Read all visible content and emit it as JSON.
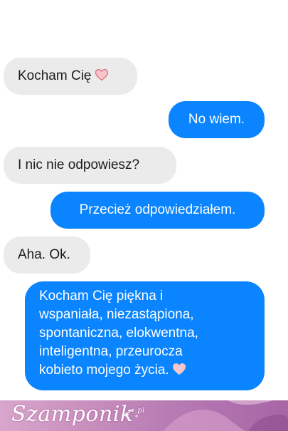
{
  "messages": [
    {
      "direction": "incoming",
      "text": "Kocham Cię",
      "icon": "heart-icon"
    },
    {
      "direction": "outgoing",
      "text": "No wiem."
    },
    {
      "direction": "incoming",
      "text": "I nic nie odpowiesz?"
    },
    {
      "direction": "outgoing",
      "text": "Przecież odpowiedziałem."
    },
    {
      "direction": "incoming",
      "text": "Aha. Ok."
    },
    {
      "direction": "outgoing",
      "lines": [
        "Kocham Cię piękna i",
        "wspaniała, niezastąpiona,",
        "spontaniczna, elokwentna,",
        "inteligentna, przeurocza",
        "kobieto mojego życia."
      ],
      "icon": "heart-icon"
    }
  ],
  "footer": {
    "logo": "Szamponik",
    "logo_tld": ".pl"
  },
  "colors": {
    "incoming_bubble": "#ebebeb",
    "outgoing_bubble": "#0a84ff",
    "heart": "#f7c6cc",
    "heart_outline": "#e0707f",
    "footer_banner": "#c98fbd"
  }
}
